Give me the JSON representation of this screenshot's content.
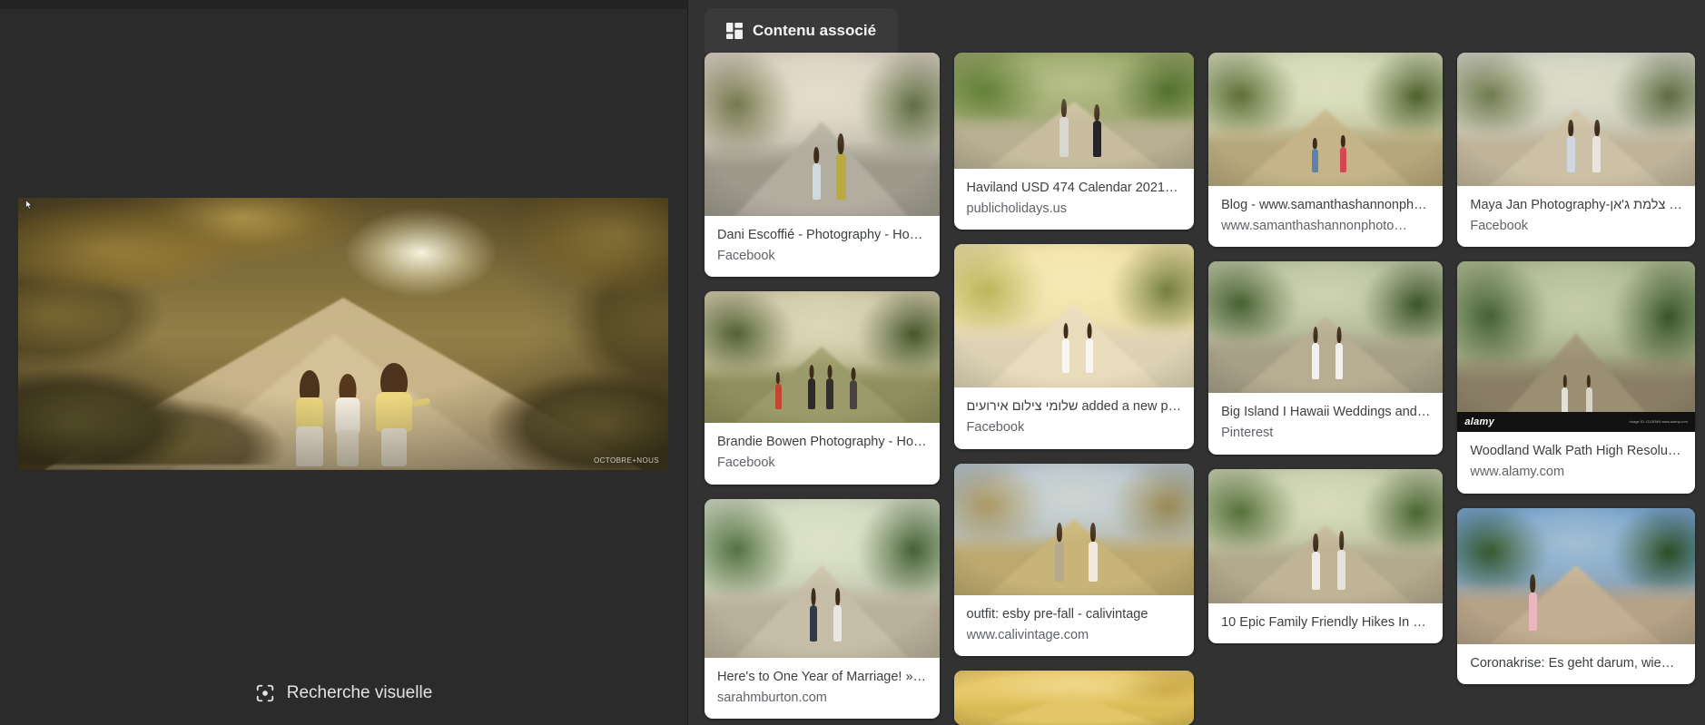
{
  "left_panel": {
    "hero_credit": "OCTOBRE+NOUS",
    "visual_search": {
      "label": "Recherche visuelle",
      "icon": "visual-search-icon"
    }
  },
  "right_panel": {
    "tab": {
      "label": "Contenu associé",
      "icon": "grid-icon",
      "active": true
    },
    "columns": [
      {
        "cards": [
          {
            "title": "Dani Escoffié - Photography - Ho…",
            "source": "Facebook",
            "thumb_height": 180,
            "scene": "path-two-children-dusk"
          },
          {
            "title": "Brandie Bowen Photography - Ho…",
            "source": "Facebook",
            "thumb_height": 145,
            "scene": "oak-tree-family-field"
          },
          {
            "title": "Here's to One Year of Marriage! »…",
            "source": "sarahmburton.com",
            "thumb_height": 175,
            "scene": "couple-green-grove"
          }
        ]
      },
      {
        "cards": [
          {
            "title": "Haviland USD 474 Calendar 2021…",
            "source": "publicholidays.us",
            "thumb_height": 128,
            "scene": "two-girls-dirt-road-green"
          },
          {
            "title": "שלומי צילום אירועים added a new p…",
            "source": "Facebook",
            "thumb_height": 158,
            "scene": "couple-white-sunlit-trail"
          },
          {
            "title": "outfit: esby pre-fall - calivintage",
            "source": "www.calivintage.com",
            "thumb_height": 145,
            "scene": "women-golden-hill"
          },
          {
            "title": "",
            "source": "",
            "thumb_height": 60,
            "scene": "golden-field-cropped"
          }
        ]
      },
      {
        "cards": [
          {
            "title": "Blog - www.samanthashannonph…",
            "source": "www.samanthashannonphoto…",
            "thumb_height": 147,
            "scene": "children-running-meadow"
          },
          {
            "title": "Big Island I Hawaii Weddings and…",
            "source": "Pinterest",
            "thumb_height": 145,
            "scene": "two-women-white-path"
          },
          {
            "title": "10 Epic Family Friendly Hikes In …",
            "source": "",
            "thumb_height": 148,
            "scene": "two-girls-forest-trail"
          }
        ]
      },
      {
        "cards": [
          {
            "title": "Maya Jan Photography-צלמת ג'אן …",
            "source": "Facebook",
            "thumb_height": 147,
            "scene": "two-girls-sandy-road"
          },
          {
            "title": "Woodland Walk Path High Resolu…",
            "source": "www.alamy.com",
            "thumb_height": 188,
            "scene": "woodland-walk-path",
            "watermark": {
              "brand": "alamy",
              "code": "Image ID: G1JKMN\nwww.alamy.com"
            }
          },
          {
            "title": "Coronakrise: Es geht darum, wie…",
            "source": "",
            "thumb_height": 150,
            "scene": "child-scooter-park"
          }
        ]
      }
    ]
  },
  "theme": {
    "panel_bg": "#2b2b2b",
    "results_bg": "#323232",
    "tab_bg": "#3a3a3a",
    "card_bg": "#ffffff",
    "title_color": "#3c4043",
    "source_color": "#5f6368",
    "text_color": "#e3e3e3"
  }
}
